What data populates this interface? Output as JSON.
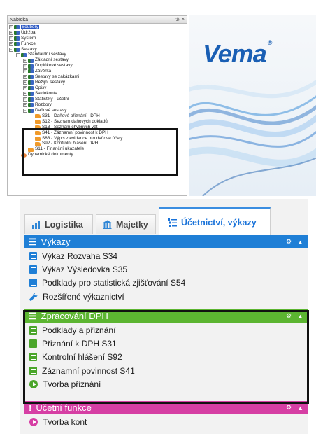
{
  "tree_panel": {
    "title": "Nabídka",
    "controls": [
      "ℬ",
      "×"
    ],
    "nodes": [
      {
        "label": "Soubory",
        "depth": 0,
        "exp": "+",
        "icon": "folder",
        "selected": true
      },
      {
        "label": "Údržba",
        "depth": 0,
        "exp": "+",
        "icon": "folder"
      },
      {
        "label": "Systém",
        "depth": 0,
        "exp": "+",
        "icon": "folder"
      },
      {
        "label": "Funkce",
        "depth": 0,
        "exp": "+",
        "icon": "folder"
      },
      {
        "label": "Sestavy",
        "depth": 0,
        "exp": "−",
        "icon": "folder"
      },
      {
        "label": "Standardní sestavy",
        "depth": 1,
        "exp": "−",
        "icon": "folder"
      },
      {
        "label": "Základní sestavy",
        "depth": 2,
        "exp": "+",
        "icon": "folder"
      },
      {
        "label": "Doplňkové sestavy",
        "depth": 2,
        "exp": "+",
        "icon": "folder"
      },
      {
        "label": "Závěrka",
        "depth": 2,
        "exp": "+",
        "icon": "folder"
      },
      {
        "label": "Sestavy se zakázkami",
        "depth": 2,
        "exp": "+",
        "icon": "folder"
      },
      {
        "label": "Režijní sestavy",
        "depth": 2,
        "exp": "+",
        "icon": "folder"
      },
      {
        "label": "Opisy",
        "depth": 2,
        "exp": "+",
        "icon": "folder"
      },
      {
        "label": "Saldokonta",
        "depth": 2,
        "exp": "+",
        "icon": "folder"
      },
      {
        "label": "Statistiky - účetní",
        "depth": 2,
        "exp": "+",
        "icon": "folder"
      },
      {
        "label": "Rozbory",
        "depth": 2,
        "exp": "+",
        "icon": "folder"
      },
      {
        "label": "Daňové sestavy",
        "depth": 2,
        "exp": "−",
        "icon": "folder"
      },
      {
        "label": "S31 - Daňové přiznání - DPH",
        "depth": 3,
        "exp": "",
        "icon": "report"
      },
      {
        "label": "S12 - Seznam daňových dokladů",
        "depth": 3,
        "exp": "",
        "icon": "report"
      },
      {
        "label": "S13 - Seznam chybných vět",
        "depth": 3,
        "exp": "",
        "icon": "report"
      },
      {
        "label": "S41 - Záznamní povinnost k DPH",
        "depth": 3,
        "exp": "",
        "icon": "report"
      },
      {
        "label": "S83 - Výpis z evidence pro daňové účely",
        "depth": 3,
        "exp": "",
        "icon": "report"
      },
      {
        "label": "S92 - Kontrolní hlášení DPH",
        "depth": 3,
        "exp": "",
        "icon": "report"
      },
      {
        "label": "S11 - Finanční ukazatele",
        "depth": 2,
        "exp": "",
        "icon": "report"
      },
      {
        "label": "Dynamické dokumenty",
        "depth": 1,
        "exp": "",
        "icon": "dyn"
      }
    ]
  },
  "logo": {
    "text": "Vema",
    "mark": "®",
    "color": "#1a5fb4"
  },
  "tabs": [
    {
      "label": "Logistika",
      "icon": "bar-chart-icon",
      "color": "#2f86d6"
    },
    {
      "label": "Majetky",
      "icon": "building-icon",
      "color": "#2f86d6"
    },
    {
      "label": "Účetnictví, výkazy",
      "icon": "list-tree-icon",
      "color": "#1a73d9",
      "active": true
    }
  ],
  "sections": [
    {
      "title": "Výkazy",
      "color": "#1f7fd6",
      "items": [
        {
          "label": "Výkaz Rozvaha S34",
          "icon": "report-icon",
          "color": "#1f7fd6"
        },
        {
          "label": "Výkaz Výsledovka S35",
          "icon": "report-icon",
          "color": "#1f7fd6"
        },
        {
          "label": "Podklady pro statistická zjišťování S54",
          "icon": "report-icon",
          "color": "#1f7fd6"
        },
        {
          "label": "Rozšířené výkaznictví",
          "icon": "wrench-icon",
          "color": "#1f7fd6"
        }
      ]
    },
    {
      "title": "Zpracování DPH",
      "color": "#5cb531",
      "items": [
        {
          "label": "Podklady a přiznání",
          "icon": "report-icon",
          "color": "#4aa52a"
        },
        {
          "label": "Přiznání k DPH S31",
          "icon": "report-icon",
          "color": "#4aa52a"
        },
        {
          "label": "Kontrolní hlášení S92",
          "icon": "report-icon",
          "color": "#4aa52a"
        },
        {
          "label": "Záznamní povinnost S41",
          "icon": "report-icon",
          "color": "#4aa52a"
        },
        {
          "label": "Tvorba přiznání",
          "icon": "play-icon",
          "color": "#4aa52a"
        }
      ]
    },
    {
      "title": "Účetní funkce",
      "color": "#d63fa4",
      "items": [
        {
          "label": "Tvorba kont",
          "icon": "play-icon",
          "color": "#d63fa4"
        }
      ]
    }
  ]
}
